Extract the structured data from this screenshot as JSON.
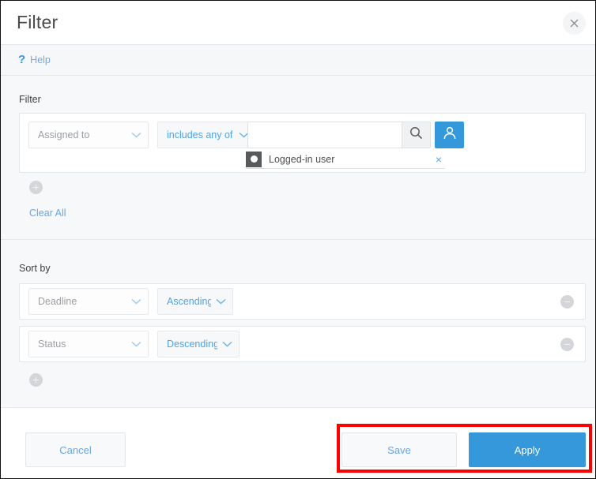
{
  "dialog": {
    "title": "Filter",
    "close_icon": "close-icon"
  },
  "helpbar": {
    "question_mark": "?",
    "label": "Help"
  },
  "filter_section": {
    "label": "Filter",
    "row": {
      "field_select": {
        "value": "Assigned to",
        "icon": "chevron-down-icon"
      },
      "operator_select": {
        "value": "includes any of",
        "icon": "chevron-down-icon"
      },
      "search": {
        "value": "",
        "placeholder": "",
        "button_icon": "search-icon"
      },
      "user_picker": {
        "icon": "user-icon"
      },
      "selected_user": {
        "name": "Logged-in user",
        "avatar_icon": "user-avatar-icon",
        "remove_icon": "close-icon",
        "remove_label": "×"
      }
    },
    "add_button_label": "+",
    "clear_all_label": "Clear All"
  },
  "sort_section": {
    "label": "Sort by",
    "rows": [
      {
        "field": "Deadline",
        "direction": "Ascending",
        "field_icon": "chevron-down-icon",
        "direction_icon": "chevron-down-icon",
        "remove_icon": "minus-icon"
      },
      {
        "field": "Status",
        "direction": "Descending",
        "field_icon": "chevron-down-icon",
        "direction_icon": "chevron-down-icon",
        "remove_icon": "minus-icon"
      }
    ],
    "add_button_label": "+"
  },
  "footer": {
    "cancel_label": "Cancel",
    "save_label": "Save",
    "apply_label": "Apply"
  },
  "colors": {
    "accent_blue": "#3498db",
    "link_blue": "#66a9e0",
    "highlight_red": "#ff0000",
    "page_bg": "#f7f8fa",
    "panel_white": "#ffffff"
  }
}
